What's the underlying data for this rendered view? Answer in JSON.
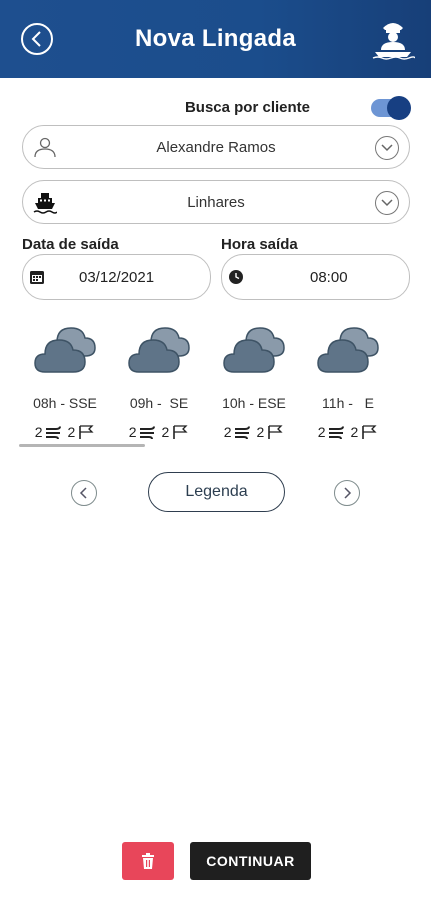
{
  "header": {
    "title": "Nova Lingada",
    "back_icon": "chevron-left-circle-icon",
    "user_icon": "sailor-on-boat-icon"
  },
  "client_search": {
    "label": "Busca por cliente",
    "enabled": true
  },
  "client_select": {
    "value": "Alexandre Ramos",
    "icon": "user-icon"
  },
  "vessel_select": {
    "value": "Linhares",
    "icon": "boat-icon"
  },
  "departure_date": {
    "label": "Data de saída",
    "value": "03/12/2021",
    "icon": "calendar-icon"
  },
  "departure_time": {
    "label": "Hora saída",
    "value": "08:00",
    "icon": "clock-icon"
  },
  "weather": [
    {
      "hour": "08h - SSE",
      "wind": "2",
      "waves": "2",
      "icon": "cloud-icon"
    },
    {
      "hour": "09h -  SE",
      "wind": "2",
      "waves": "2",
      "icon": "cloud-icon"
    },
    {
      "hour": "10h - ESE",
      "wind": "2",
      "waves": "2",
      "icon": "cloud-icon"
    },
    {
      "hour": "11h -   E",
      "wind": "2",
      "waves": "2",
      "icon": "cloud-icon"
    }
  ],
  "legend_button": "Legenda",
  "actions": {
    "delete_icon": "trash-icon",
    "continue_label": "CONTINUAR"
  },
  "colors": {
    "header": "#1b4d8c",
    "toggle_knob": "#173f82",
    "delete": "#e8465a",
    "continue": "#1f1f1f",
    "cloud": "#5f7488"
  }
}
